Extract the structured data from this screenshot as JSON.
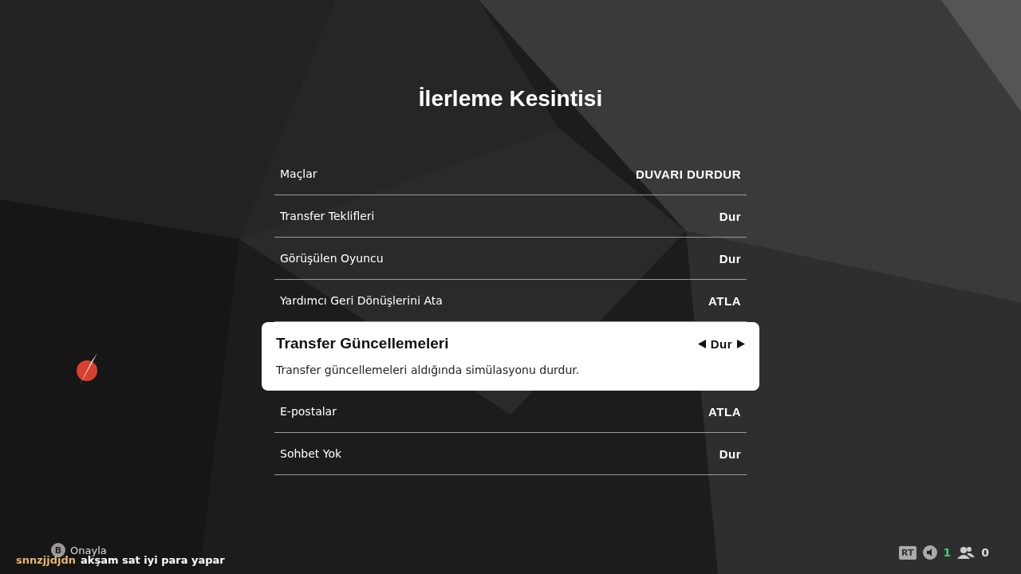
{
  "title": "İlerleme Kesintisi",
  "rows": [
    {
      "label": "Maçlar",
      "value": "DUVARI DURDUR",
      "selected": false
    },
    {
      "label": "Transfer Teklifleri",
      "value": "Dur",
      "selected": false
    },
    {
      "label": "Görüşülen Oyuncu",
      "value": "Dur",
      "selected": false
    },
    {
      "label": "Yardımcı Geri Dönüşlerini Ata",
      "value": "ATLA",
      "selected": false
    },
    {
      "label": "Transfer Güncellemeleri",
      "value": "Dur",
      "selected": true,
      "description": "Transfer güncellemeleri aldığında simülasyonu durdur."
    },
    {
      "label": "E-postalar",
      "value": "ATLA",
      "selected": false
    },
    {
      "label": "Sohbet Yok",
      "value": "Dur",
      "selected": false
    }
  ],
  "footer_hint": {
    "button": "B",
    "label": "Onayla"
  },
  "chat": {
    "user": "snnzjjdjdn",
    "message": "akşam sat iyi para yapar"
  },
  "status": {
    "trigger": "RT",
    "voice_count": "1",
    "party_count": "0"
  }
}
